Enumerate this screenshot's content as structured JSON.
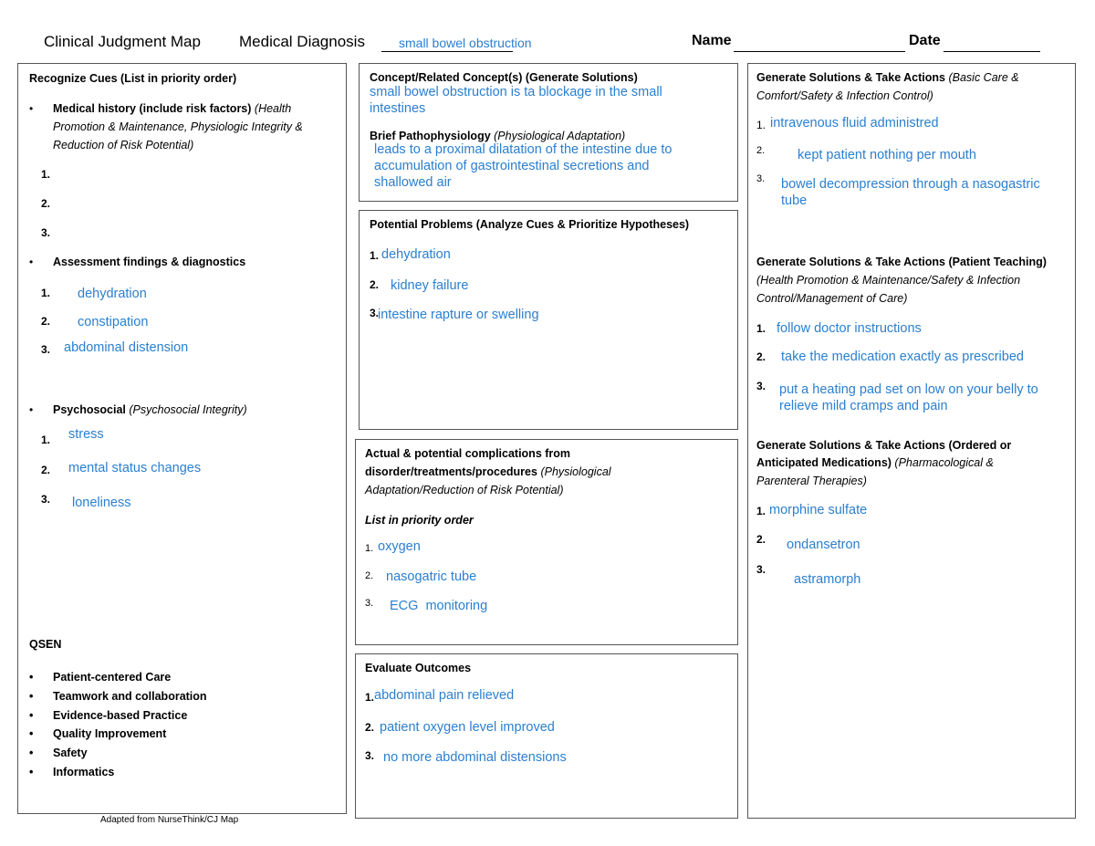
{
  "header": {
    "title": "Clinical Judgment Map",
    "diagnosis_label": "Medical Diagnosis",
    "diagnosis_value": "small bowel obstruction",
    "name_label": "Name",
    "name_value": "",
    "date_label": "Date",
    "date_value": ""
  },
  "recognize_cues": {
    "title": "Recognize Cues (List in priority order)",
    "medical_history": {
      "label": "Medical history (include risk factors)",
      "sub": "(Health Promotion & Maintenance, Physiologic Integrity & Reduction of Risk Potential)",
      "sub_line1": "(Health",
      "sub_line2": "Promotion & Maintenance, Physiologic Integrity &",
      "sub_line3": "Reduction of Risk Potential)",
      "items": [
        "",
        "",
        ""
      ]
    },
    "assessment": {
      "label": "Assessment findings & diagnostics",
      "items": [
        "dehydration",
        "constipation",
        "abdominal distension"
      ]
    },
    "psychosocial": {
      "label": "Psychosocial",
      "sub": "(Psychosocial Integrity)",
      "items": [
        "stress",
        "mental status changes",
        "loneliness"
      ]
    },
    "numbers": [
      "1.",
      "2.",
      "3."
    ]
  },
  "qsen": {
    "title": "QSEN",
    "items": [
      "Patient-centered Care",
      "Teamwork and collaboration",
      "Evidence-based Practice",
      "Quality Improvement",
      "Safety",
      "Informatics"
    ]
  },
  "footer": "Adapted from NurseThink/CJ Map",
  "concept": {
    "title": "Concept/Related Concept(s) (Generate Solutions)",
    "value_line1": "small bowel obstruction is ta blockage in the small",
    "value_line2": "intestines",
    "patho_label": "Brief Pathophysiology",
    "patho_sub": "(Physiological Adaptation)",
    "patho_line1": "leads to a proximal dilatation of the intestine due to",
    "patho_line2": "accumulation of gastrointestinal secretions and",
    "patho_line3": "shallowed air"
  },
  "potential_problems": {
    "title": "Potential Problems (Analyze Cues & Prioritize Hypotheses)",
    "items": [
      "dehydration",
      "kidney failure",
      "intestine rapture or swelling"
    ]
  },
  "complications": {
    "title_line1": "Actual & potential complications from",
    "title_line2": "disorder/treatments/procedures",
    "sub_line1": "(Physiological",
    "sub_line2": "Adaptation/Reduction of Risk Potential)",
    "list_label": "List in priority order",
    "items": [
      "oxygen",
      "nasogatric tube",
      "ECG  monitoring"
    ]
  },
  "evaluate": {
    "title": "Evaluate Outcomes",
    "items": [
      "abdominal pain relieved",
      "patient oxygen level improved",
      "no more abdominal distensions"
    ]
  },
  "basic_care": {
    "title": "Generate Solutions & Take Actions",
    "sub_line1": "(Basic Care &",
    "sub_line2": "Comfort/Safety & Infection Control)",
    "items": [
      "intravenous fluid administred",
      "kept patient nothing per mouth",
      "bowel decompression through a nasogastric",
      "tube"
    ]
  },
  "teaching": {
    "title": "Generate Solutions & Take Actions (Patient Teaching)",
    "sub_line1": "(Health Promotion & Maintenance/Safety & Infection",
    "sub_line2": "Control/Management of Care)",
    "items": [
      "follow doctor instructions",
      "take the medication exactly as prescribed",
      "put a heating pad set on low on your belly to",
      "relieve mild cramps and pain"
    ]
  },
  "medications": {
    "title_line1": "Generate Solutions & Take Actions (Ordered or",
    "title_line2": "Anticipated Medications)",
    "sub_line1": "(Pharmacological &",
    "sub_line2": "Parenteral Therapies)",
    "items": [
      "morphine sulfate",
      "ondansetron",
      "astramorph"
    ]
  },
  "colors": {
    "answer_blue": "#2a7fd0",
    "border": "#555555"
  }
}
